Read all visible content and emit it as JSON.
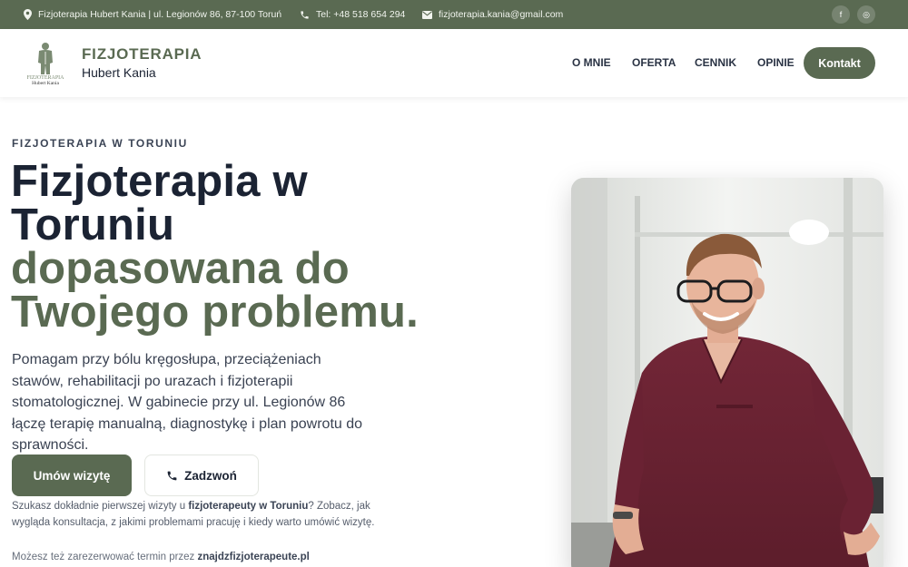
{
  "topbar": {
    "address": "Fizjoterapia Hubert Kania | ul. Legionów 86, 87-100 Toruń",
    "phone": "Tel: +48 518 654 294",
    "email": "fizjoterapia.kania@gmail.com",
    "social": [
      {
        "icon": "facebook-icon",
        "glyph": "f"
      },
      {
        "icon": "instagram-icon",
        "glyph": "◎"
      }
    ]
  },
  "header": {
    "logo_text_top": "FIZJOTERAPIA",
    "logo_text_bottom": "Hubert Kania",
    "brand_title": "FIZJOTERAPIA",
    "brand_subtitle": "Hubert Kania",
    "nav": [
      "O MNIE",
      "OFERTA",
      "CENNIK",
      "OPINIE"
    ],
    "cta": "Kontakt"
  },
  "hero": {
    "eyebrow": "FIZJOTERAPIA W TORUNIU",
    "title_dark_1": "Fizjoterapia w",
    "title_dark_2": "Toruniu",
    "title_green_1": "dopasowana do",
    "title_green_2": "Twojego problemu.",
    "lead": "Pomagam przy bólu kręgosłupa, przeciążeniach stawów, rehabilitacji po urazach i fizjoterapii stomatologicznej. W gabinecie przy ul. Legionów 86 łączę terapię manualną, diagnostykę i plan powrotu do sprawności.",
    "btn_primary": "Umów wizytę",
    "btn_secondary": "Zadzwoń",
    "info_pre": "Szukasz dokładnie pierwszej wizyty u ",
    "info_bold": "fizjoterapeuty w Toruniu",
    "info_post": "? Zobacz, jak wygląda konsultacja, z jakimi problemami pracuję i kiedy warto umówić wizytę.",
    "booking_pre": "Możesz też zarezerwować termin przez ",
    "booking_bold": "znajdzfizjoterapeute.pl"
  },
  "colors": {
    "brand_green": "#5a6a52",
    "text_dark": "#1b2333",
    "scrubs": "#6b2333"
  }
}
